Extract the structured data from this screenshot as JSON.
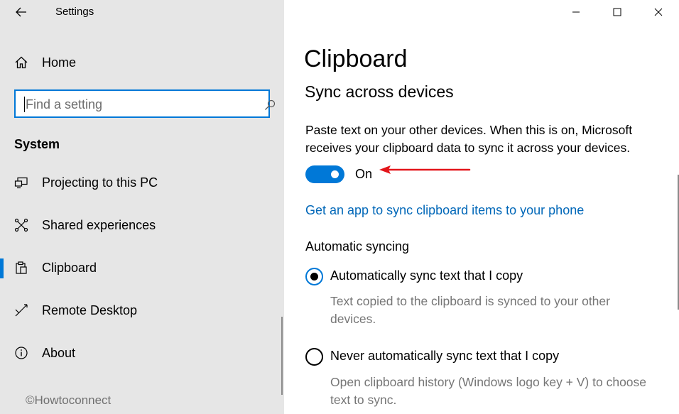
{
  "window": {
    "app_title": "Settings"
  },
  "sidebar": {
    "home_label": "Home",
    "search_placeholder": "Find a setting",
    "section_title": "System",
    "items": [
      {
        "label": "Projecting to this PC",
        "icon": "projector-icon"
      },
      {
        "label": "Shared experiences",
        "icon": "shared-experiences-icon"
      },
      {
        "label": "Clipboard",
        "icon": "clipboard-icon",
        "selected": true
      },
      {
        "label": "Remote Desktop",
        "icon": "remote-desktop-icon"
      },
      {
        "label": "About",
        "icon": "info-icon"
      }
    ],
    "watermark": "©Howtoconnect"
  },
  "main": {
    "page_title": "Clipboard",
    "group_title": "Sync across devices",
    "description": "Paste text on your other devices. When this is on, Microsoft receives your clipboard data to sync it across your devices.",
    "toggle": {
      "state_label": "On",
      "on": true
    },
    "link": "Get an app to sync clipboard items to your phone",
    "auto_sync_heading": "Automatic syncing",
    "options": [
      {
        "label": "Automatically sync text that I copy",
        "description": "Text copied to the clipboard is synced to your other devices.",
        "selected": true
      },
      {
        "label": "Never automatically sync text that I copy",
        "description": "Open clipboard history (Windows logo key + V) to choose text to sync.",
        "selected": false
      }
    ]
  },
  "colors": {
    "accent": "#0078d7",
    "link": "#0067b8",
    "sidebar_bg": "#e6e6e6",
    "annotation_arrow": "#e3151a"
  }
}
